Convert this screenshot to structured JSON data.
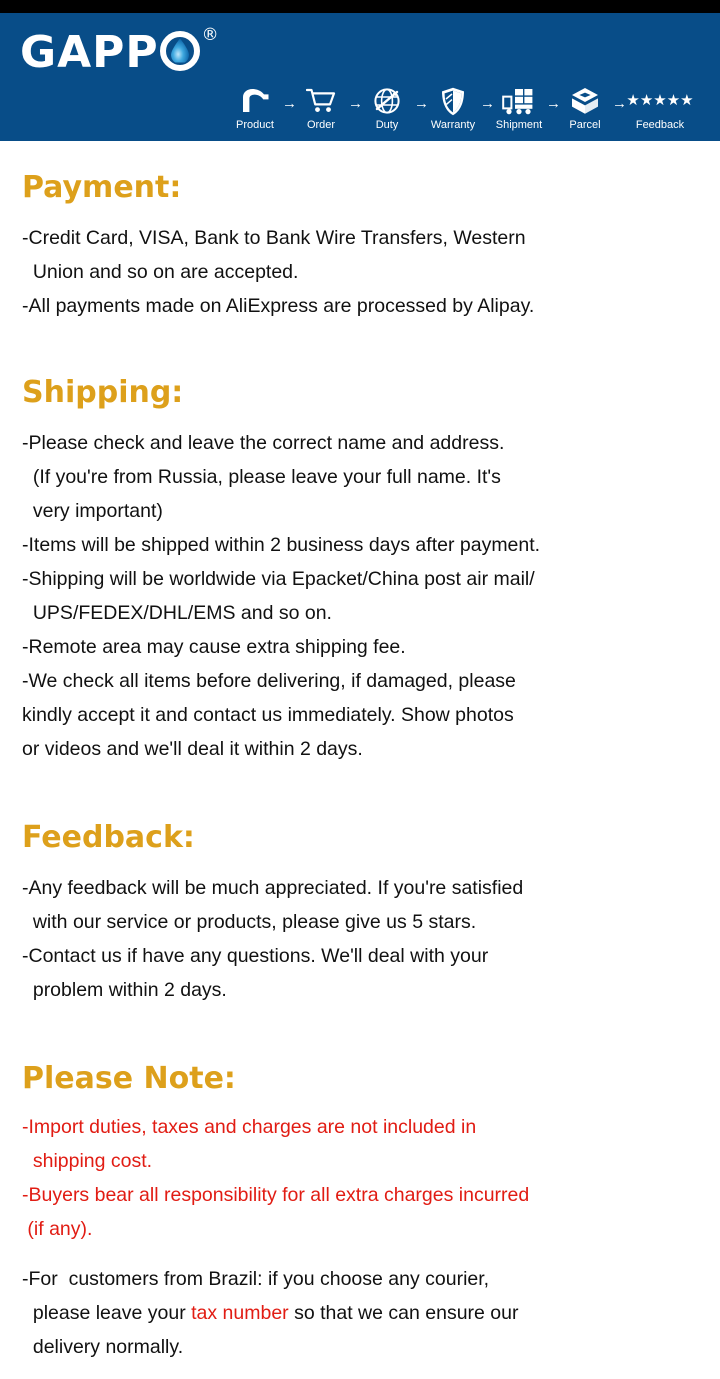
{
  "colors": {
    "banner_blue": "#084D88",
    "heading_gold": "#DDA01B",
    "alert_red": "#E11C13",
    "top_bar_black": "#000000",
    "text_black": "#111111",
    "white": "#FFFFFF"
  },
  "banner": {
    "brand": "GAPP",
    "brand_trademark": "®",
    "logo_drop_icon": "water-drop-icon",
    "arrow_glyph": "→",
    "stars_glyph": "★★★★★",
    "steps": [
      {
        "label": "Product",
        "icon": "faucet-icon"
      },
      {
        "label": "Order",
        "icon": "shopping-cart-icon"
      },
      {
        "label": "Duty",
        "icon": "globe-icon"
      },
      {
        "label": "Warranty",
        "icon": "shield-icon"
      },
      {
        "label": "Shipment",
        "icon": "delivery-truck-icon"
      },
      {
        "label": "Parcel",
        "icon": "open-box-icon"
      },
      {
        "label": "Feedback",
        "icon": "five-stars-icon"
      }
    ]
  },
  "sections": {
    "payment": {
      "title": "Payment:",
      "body": "-Credit Card, VISA, Bank to Bank Wire Transfers, Western\n  Union and so on are accepted.\n-All payments made on AliExpress are processed by Alipay."
    },
    "shipping": {
      "title": "Shipping:",
      "body": "-Please check and leave the correct name and address.\n  (If you're from Russia, please leave your full name. It's\n  very important)\n-Items will be shipped within 2 business days after payment.\n-Shipping will be worldwide via Epacket/China post air mail/\n  UPS/FEDEX/DHL/EMS and so on.\n-Remote area may cause extra shipping fee.\n-We check all items before delivering, if damaged, please\nkindly accept it and contact us immediately. Show photos\nor videos and we'll deal it within 2 days."
    },
    "feedback": {
      "title": "Feedback:",
      "body": "-Any feedback will be much appreciated. If you're satisfied\n  with our service or products, please give us 5 stars.\n-Contact us if have any questions. We'll deal with your\n  problem within 2 days."
    },
    "note": {
      "title": "Please Note:",
      "body_red": "-Import duties, taxes and charges are not included in\n  shipping cost.\n-Buyers bear all responsibility for all extra charges incurred\n (if any).",
      "body_mixed_part1": "-For  customers from Brazil: if you choose any courier,\n  please leave your ",
      "body_mixed_highlight": "tax number",
      "body_mixed_part2": " so that we can ensure our\n  delivery normally."
    }
  }
}
